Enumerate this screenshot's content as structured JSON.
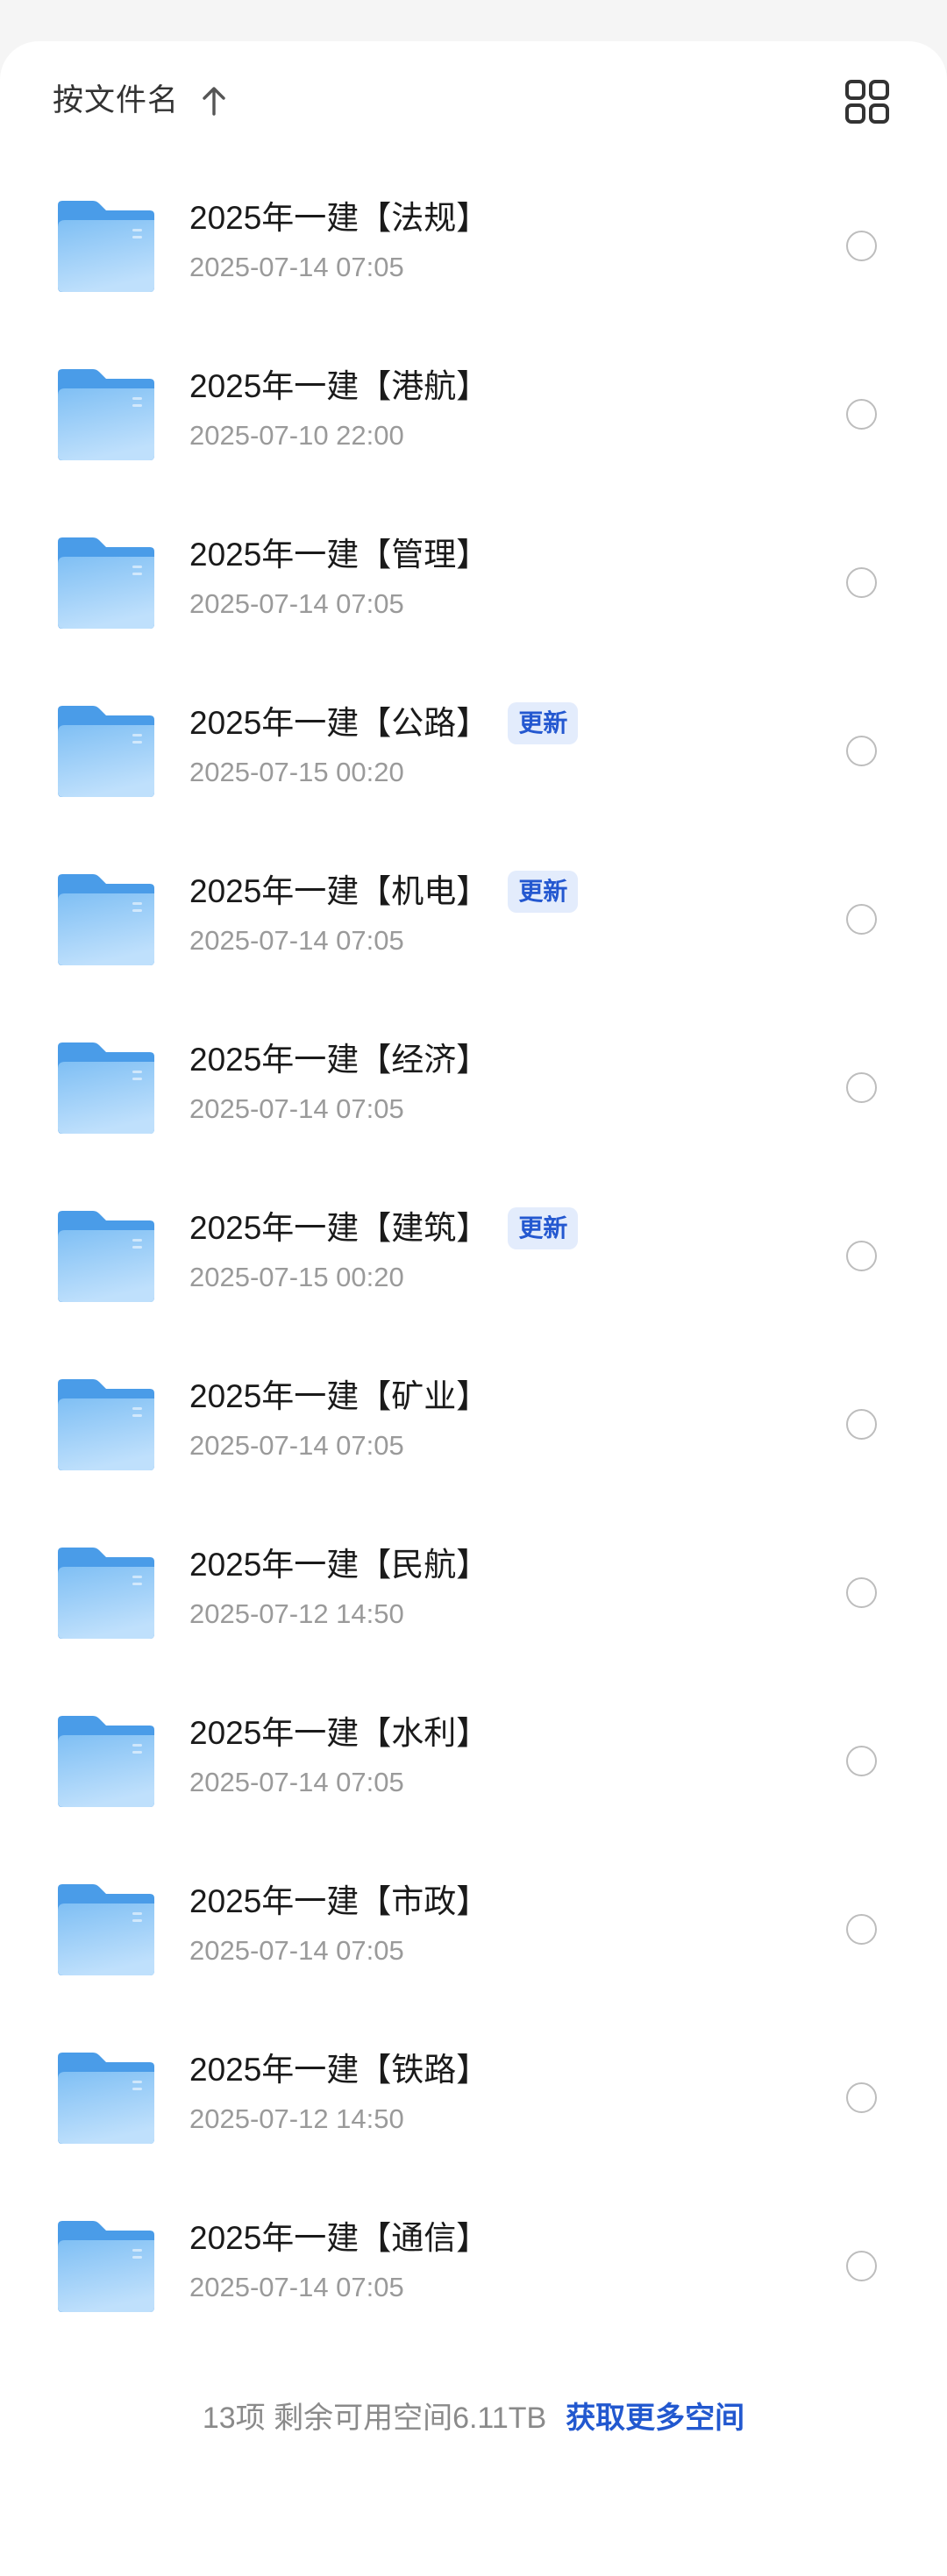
{
  "header": {
    "sort_label": "按文件名",
    "sort_direction_icon": "arrow-up-icon",
    "view_toggle_icon": "grid-view-icon"
  },
  "icons": {
    "file_icon": "folder-icon",
    "select_icon": "radio-unchecked-icon"
  },
  "colors": {
    "background": "#f5f5f5",
    "accent": "#2258cf",
    "badge_bg": "#e3ecfc",
    "badge_text": "#2458d0",
    "folder_back": "#4a9ce8",
    "folder_front": "#8ec8f7"
  },
  "files": [
    {
      "name": "2025年一建【法规】",
      "date": "2025-07-14 07:05"
    },
    {
      "name": "2025年一建【港航】",
      "date": "2025-07-10 22:00"
    },
    {
      "name": "2025年一建【管理】",
      "date": "2025-07-14 07:05"
    },
    {
      "name": "2025年一建【公路】",
      "date": "2025-07-15 00:20",
      "badge": "更新"
    },
    {
      "name": "2025年一建【机电】",
      "date": "2025-07-14 07:05",
      "badge": "更新"
    },
    {
      "name": "2025年一建【经济】",
      "date": "2025-07-14 07:05"
    },
    {
      "name": "2025年一建【建筑】",
      "date": "2025-07-15 00:20",
      "badge": "更新"
    },
    {
      "name": "2025年一建【矿业】",
      "date": "2025-07-14 07:05"
    },
    {
      "name": "2025年一建【民航】",
      "date": "2025-07-12 14:50"
    },
    {
      "name": "2025年一建【水利】",
      "date": "2025-07-14 07:05"
    },
    {
      "name": "2025年一建【市政】",
      "date": "2025-07-14 07:05"
    },
    {
      "name": "2025年一建【铁路】",
      "date": "2025-07-12 14:50"
    },
    {
      "name": "2025年一建【通信】",
      "date": "2025-07-14 07:05"
    }
  ],
  "footer": {
    "summary": "13项 剩余可用空间6.11TB",
    "action_label": "获取更多空间"
  }
}
